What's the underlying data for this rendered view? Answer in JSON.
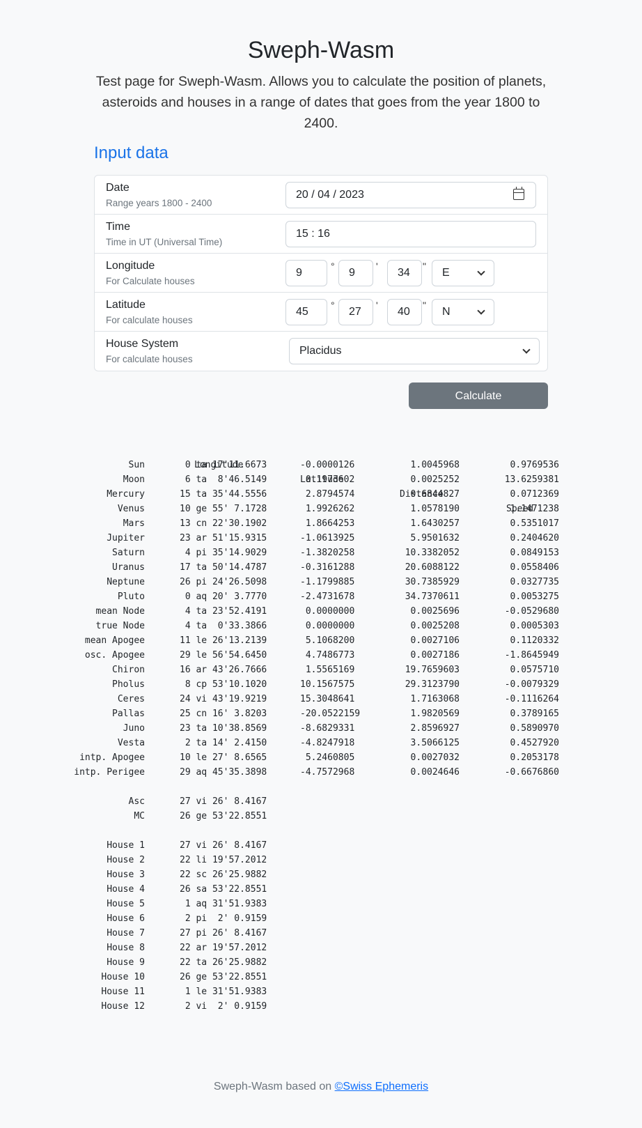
{
  "header": {
    "title": "Sweph-Wasm",
    "lead": "Test page for Sweph-Wasm. Allows you to calculate the position of planets, asteroids and houses in a range of dates that goes from the year 1800 to 2400."
  },
  "input": {
    "section_title": "Input data",
    "date": {
      "label": "Date",
      "sub": "Range years 1800 - 2400",
      "value": "20 / 04 / 2023"
    },
    "time": {
      "label": "Time",
      "sub": "Time in UT (Universal Time)",
      "value": "15 : 16"
    },
    "longitude": {
      "label": "Longitude",
      "sub": "For Calculate houses",
      "deg": "9",
      "min": "9",
      "sec": "34",
      "dir": "E"
    },
    "latitude": {
      "label": "Latitude",
      "sub": "For calculate houses",
      "deg": "45",
      "min": "27",
      "sec": "40",
      "dir": "N"
    },
    "house_system": {
      "label": "House System",
      "sub": "For calculate houses",
      "value": "Placidus"
    },
    "symbols": {
      "deg": "°",
      "min": "'",
      "sec": "\""
    },
    "calculate_label": "Calculate"
  },
  "results": {
    "headers": {
      "lon": "Longitude",
      "lat": "Latitude",
      "dist": "Distance",
      "speed": "Speed"
    },
    "bodies": [
      {
        "name": "Sun",
        "lon": " 0 ta 17'11.6673",
        "lat": "-0.0000126",
        "dist": "1.0045968",
        "speed": "0.9769536"
      },
      {
        "name": "Moon",
        "lon": " 6 ta  8'46.5149",
        "lat": " 0.1973602",
        "dist": "0.0025252",
        "speed": "13.6259381"
      },
      {
        "name": "Mercury",
        "lon": "15 ta 35'44.5556",
        "lat": " 2.8794574",
        "dist": "0.6844827",
        "speed": "0.0712369"
      },
      {
        "name": "Venus",
        "lon": "10 ge 55' 7.1728",
        "lat": " 1.9926262",
        "dist": "1.0578190",
        "speed": "1.1471238"
      },
      {
        "name": "Mars",
        "lon": "13 cn 22'30.1902",
        "lat": " 1.8664253",
        "dist": "1.6430257",
        "speed": "0.5351017"
      },
      {
        "name": "Jupiter",
        "lon": "23 ar 51'15.9315",
        "lat": "-1.0613925",
        "dist": "5.9501632",
        "speed": "0.2404620"
      },
      {
        "name": "Saturn",
        "lon": " 4 pi 35'14.9029",
        "lat": "-1.3820258",
        "dist": "10.3382052",
        "speed": "0.0849153"
      },
      {
        "name": "Uranus",
        "lon": "17 ta 50'14.4787",
        "lat": "-0.3161288",
        "dist": "20.6088122",
        "speed": "0.0558406"
      },
      {
        "name": "Neptune",
        "lon": "26 pi 24'26.5098",
        "lat": "-1.1799885",
        "dist": "30.7385929",
        "speed": "0.0327735"
      },
      {
        "name": "Pluto",
        "lon": " 0 aq 20' 3.7770",
        "lat": "-2.4731678",
        "dist": "34.7370611",
        "speed": "0.0053275"
      },
      {
        "name": "mean Node",
        "lon": " 4 ta 23'52.4191",
        "lat": " 0.0000000",
        "dist": "0.0025696",
        "speed": "-0.0529680"
      },
      {
        "name": "true Node",
        "lon": " 4 ta  0'33.3866",
        "lat": " 0.0000000",
        "dist": "0.0025208",
        "speed": "0.0005303"
      },
      {
        "name": "mean Apogee",
        "lon": "11 le 26'13.2139",
        "lat": " 5.1068200",
        "dist": "0.0027106",
        "speed": "0.1120332"
      },
      {
        "name": "osc. Apogee",
        "lon": "29 le 56'54.6450",
        "lat": " 4.7486773",
        "dist": "0.0027186",
        "speed": "-1.8645949"
      },
      {
        "name": "Chiron",
        "lon": "16 ar 43'26.7666",
        "lat": " 1.5565169",
        "dist": "19.7659603",
        "speed": "0.0575710"
      },
      {
        "name": "Pholus",
        "lon": " 8 cp 53'10.1020",
        "lat": "10.1567575",
        "dist": "29.3123790",
        "speed": "-0.0079329"
      },
      {
        "name": "Ceres",
        "lon": "24 vi 43'19.9219",
        "lat": "15.3048641",
        "dist": "1.7163068",
        "speed": "-0.1116264"
      },
      {
        "name": "Pallas",
        "lon": "25 cn 16' 3.8203",
        "lat": "-20.0522159",
        "dist": "1.9820569",
        "speed": "0.3789165"
      },
      {
        "name": "Juno",
        "lon": "23 ta 10'38.8569",
        "lat": "-8.6829331",
        "dist": "2.8596927",
        "speed": "0.5890970"
      },
      {
        "name": "Vesta",
        "lon": " 2 ta 14' 2.4150",
        "lat": "-4.8247918",
        "dist": "3.5066125",
        "speed": "0.4527920"
      },
      {
        "name": "intp. Apogee",
        "lon": "10 le 27' 8.6565",
        "lat": " 5.2460805",
        "dist": "0.0027032",
        "speed": "0.2053178"
      },
      {
        "name": "intp. Perigee",
        "lon": "29 aq 45'35.3898",
        "lat": "-4.7572968",
        "dist": "0.0024646",
        "speed": "-0.6676860"
      }
    ],
    "angles": [
      {
        "name": "Asc",
        "lon": "27 vi 26' 8.4167"
      },
      {
        "name": "MC",
        "lon": "26 ge 53'22.8551"
      }
    ],
    "houses": [
      {
        "name": "House 1",
        "lon": "27 vi 26' 8.4167"
      },
      {
        "name": "House 2",
        "lon": "22 li 19'57.2012"
      },
      {
        "name": "House 3",
        "lon": "22 sc 26'25.9882"
      },
      {
        "name": "House 4",
        "lon": "26 sa 53'22.8551"
      },
      {
        "name": "House 5",
        "lon": " 1 aq 31'51.9383"
      },
      {
        "name": "House 6",
        "lon": " 2 pi  2' 0.9159"
      },
      {
        "name": "House 7",
        "lon": "27 pi 26' 8.4167"
      },
      {
        "name": "House 8",
        "lon": "22 ar 19'57.2012"
      },
      {
        "name": "House 9",
        "lon": "22 ta 26'25.9882"
      },
      {
        "name": "House 10",
        "lon": "26 ge 53'22.8551"
      },
      {
        "name": "House 11",
        "lon": " 1 le 31'51.9383"
      },
      {
        "name": "House 12",
        "lon": " 2 vi  2' 0.9159"
      }
    ]
  },
  "footer": {
    "text": "Sweph-Wasm based on ",
    "link": "©Swiss Ephemeris"
  }
}
